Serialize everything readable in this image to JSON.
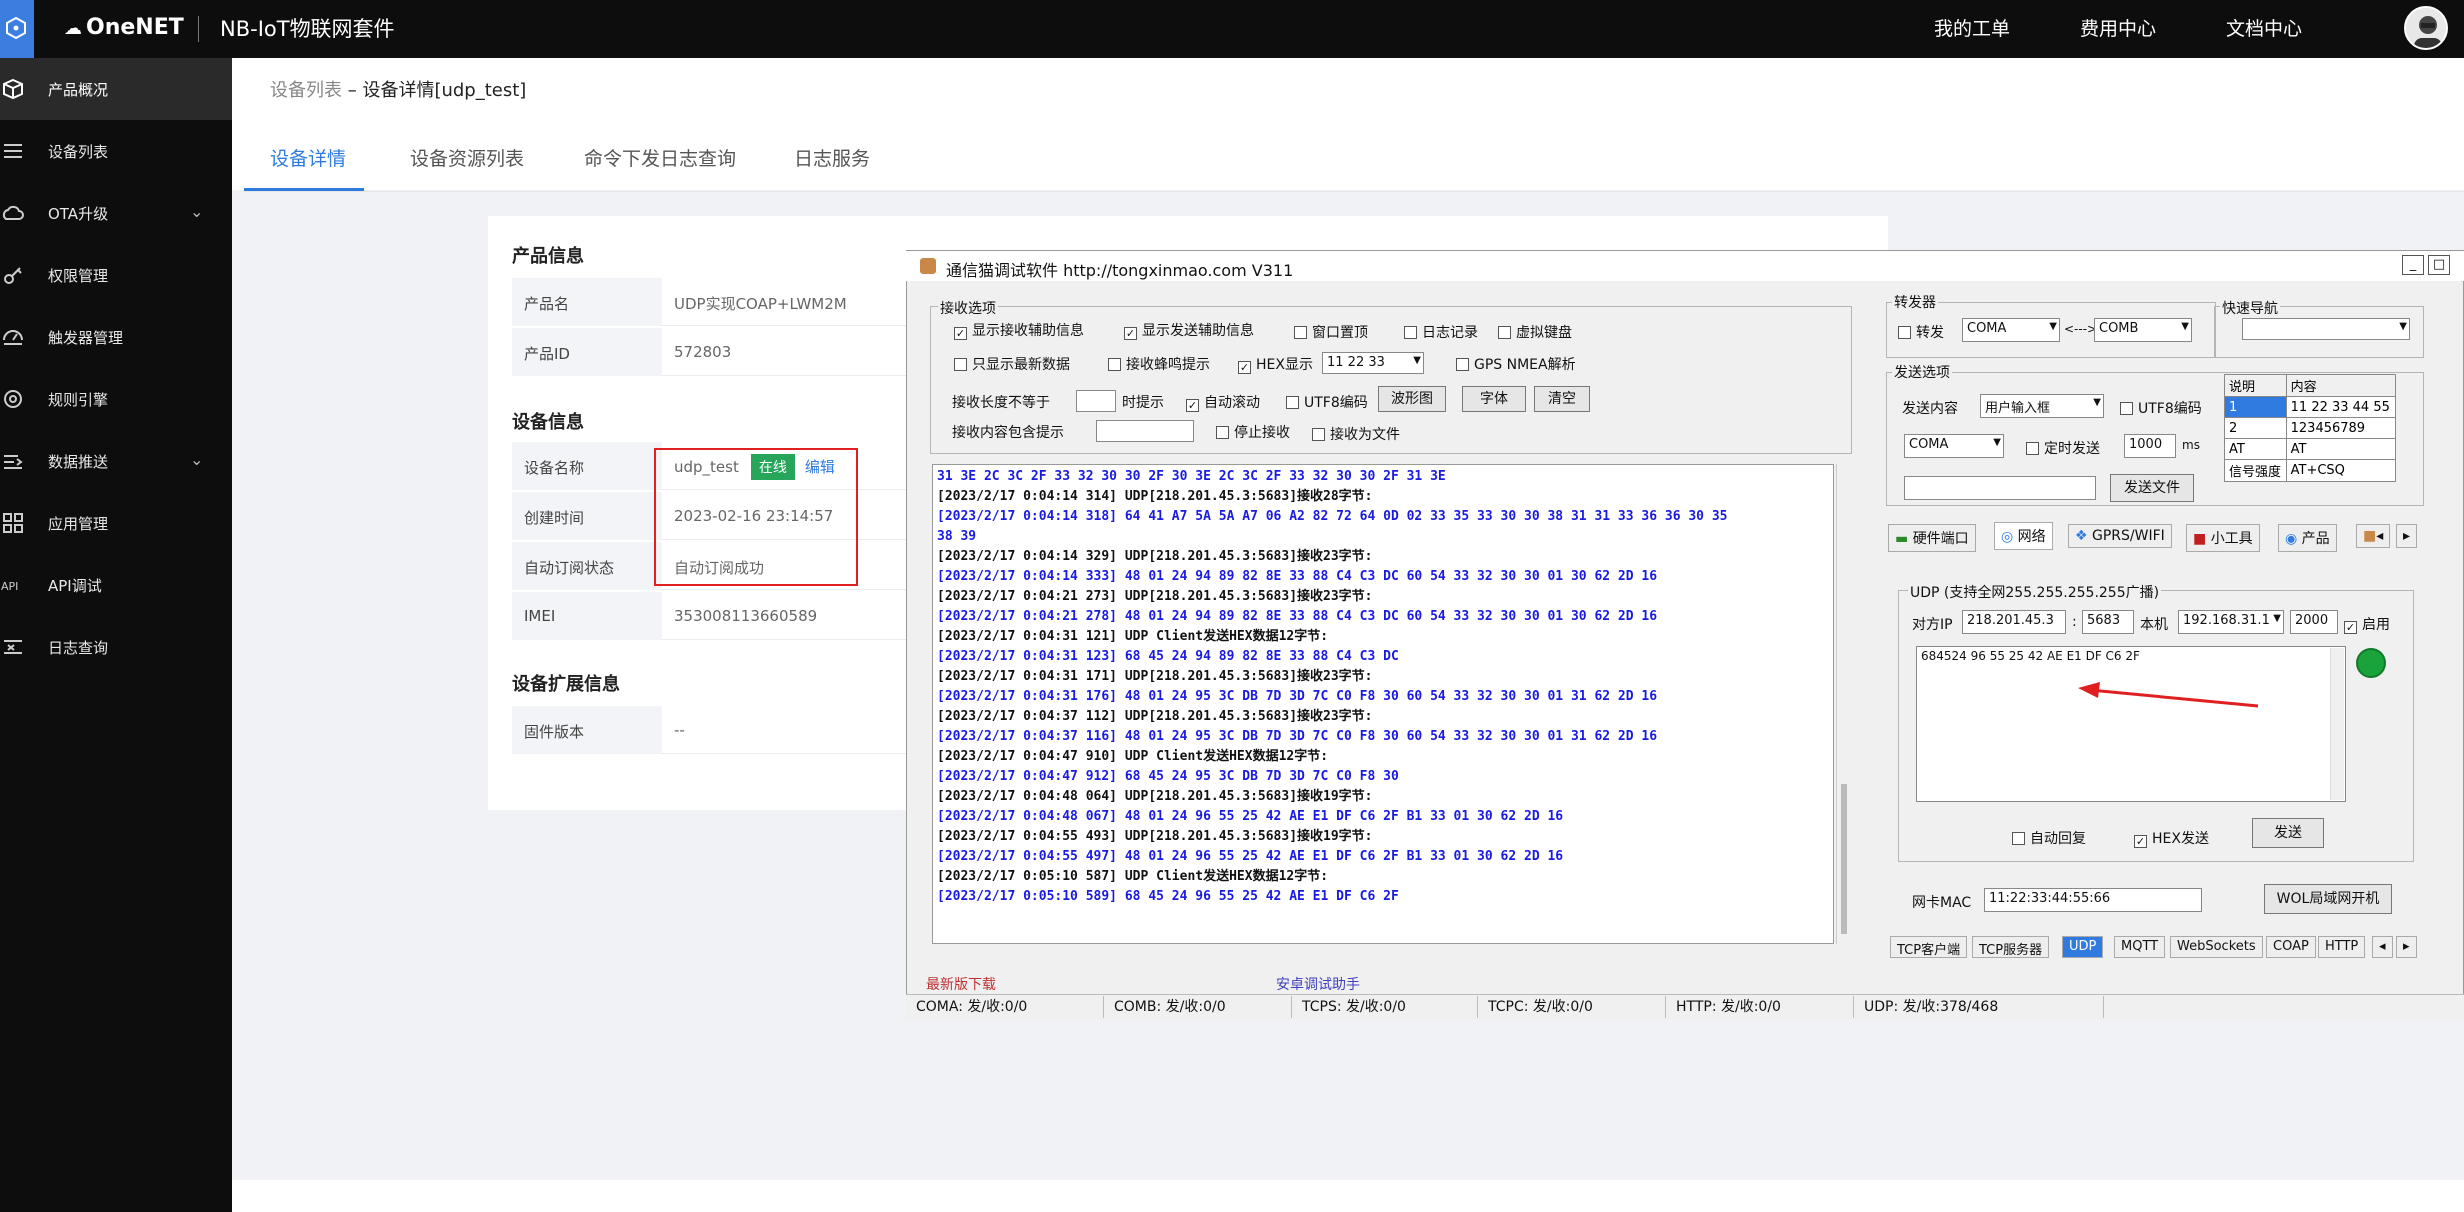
{
  "topbar": {
    "brand": "OneNET",
    "suite": "NB-IoT物联网套件",
    "nav": [
      "我的工单",
      "费用中心",
      "文档中心"
    ]
  },
  "sidebar": {
    "items": [
      {
        "label": "产品概况",
        "icon": "cube-icon",
        "active": true
      },
      {
        "label": "设备列表",
        "icon": "list-icon"
      },
      {
        "label": "OTA升级",
        "icon": "cloud-upload-icon",
        "expand": true
      },
      {
        "label": "权限管理",
        "icon": "key-icon"
      },
      {
        "label": "触发器管理",
        "icon": "trigger-icon"
      },
      {
        "label": "规则引擎",
        "icon": "rule-icon"
      },
      {
        "label": "数据推送",
        "icon": "push-icon",
        "expand": true
      },
      {
        "label": "应用管理",
        "icon": "grid-icon"
      },
      {
        "label": "API调试",
        "icon": "api-icon"
      },
      {
        "label": "日志查询",
        "icon": "log-icon"
      }
    ],
    "chevron": "⌄"
  },
  "breadcrumb": {
    "parent": "设备列表",
    "sep": " – ",
    "current": "设备详情[udp_test]"
  },
  "tabs": [
    "设备详情",
    "设备资源列表",
    "命令下发日志查询",
    "日志服务"
  ],
  "product": {
    "title": "产品信息",
    "rows": [
      {
        "key": "产品名",
        "value": "UDP实现COAP+LWM2M"
      },
      {
        "key": "产品ID",
        "value": "572803"
      }
    ]
  },
  "device": {
    "title": "设备信息",
    "name_key": "设备名称",
    "name_value": "udp_test",
    "status": "在线",
    "edit": "编辑",
    "rows": [
      {
        "key": "创建时间",
        "value": "2023-02-16 23:14:57"
      },
      {
        "key": "自动订阅状态",
        "value": "自动订阅成功"
      },
      {
        "key": "IMEI",
        "value": "353008113660589"
      }
    ]
  },
  "extension": {
    "title": "设备扩展信息",
    "rows": [
      {
        "key": "固件版本",
        "value": "--"
      }
    ]
  },
  "tool": {
    "title": "通信猫调试软件   http://tongxinmao.com   V311",
    "win_buttons": [
      "_",
      "□"
    ],
    "recv_group": "接收选项",
    "recv_opts": [
      {
        "label": "显示接收辅助信息",
        "checked": true
      },
      {
        "label": "显示发送辅助信息",
        "checked": true
      },
      {
        "label": "窗口置顶",
        "checked": false
      },
      {
        "label": "日志记录",
        "checked": false
      },
      {
        "label": "虚拟键盘",
        "checked": false
      },
      {
        "label": "只显示最新数据",
        "checked": false
      },
      {
        "label": "接收蜂鸣提示",
        "checked": false
      },
      {
        "label": "HEX显示",
        "checked": true
      },
      {
        "label": "GPS NMEA解析",
        "checked": false
      },
      {
        "label": "自动滚动",
        "checked": true
      },
      {
        "label": "UTF8编码",
        "checked": false
      },
      {
        "label": "停止接收",
        "checked": false
      },
      {
        "label": "接收为文件",
        "checked": false
      }
    ],
    "hex_sample": "11 22 33",
    "len_label": "接收长度不等于",
    "len_hint": "时提示",
    "contain_label": "接收内容包含提示",
    "btn_wave": "波形图",
    "btn_font": "字体",
    "btn_clear": "清空",
    "forward": {
      "group": "转发器",
      "cb": "转发",
      "from": "COMA",
      "arrow": "<--->",
      "to": "COMB"
    },
    "quick": {
      "group": "快速导航",
      "value": ""
    },
    "send": {
      "group": "发送选项",
      "content_label": "发送内容",
      "content_value": "用户输入框",
      "utf8": "UTF8编码",
      "port": "COMA",
      "timer": "定时发送",
      "interval": "1000",
      "unit": "ms",
      "file_btn": "发送文件"
    },
    "quick_table": {
      "headers": [
        "说明",
        "内容"
      ],
      "rows": [
        [
          "1",
          "11 22 33 44 55"
        ],
        [
          "2",
          "123456789"
        ],
        [
          "AT",
          "AT"
        ],
        [
          "信号强度",
          "AT+CSQ"
        ]
      ]
    },
    "mid_tabs": [
      "硬件端口",
      "网络",
      "GPRS/WIFI",
      "小工具",
      "产品",
      "◂",
      "▸"
    ],
    "udp": {
      "group": "UDP (支持全网255.255.255.255广播)",
      "peer_label": "对方IP",
      "peer_ip": "218.201.45.3",
      "peer_port": "5683",
      "local_label": "本机",
      "local_ip": "192.168.31.1",
      "local_port": "2000",
      "enable": "启用",
      "send_text": "684524 96 55 25 42 AE E1 DF C6 2F",
      "auto_reply": "自动回复",
      "hex_send": "HEX发送",
      "send_btn": "发送"
    },
    "mac_label": "网卡MAC",
    "mac": "11:22:33:44:55:66",
    "wol_btn": "WOL局域网开机",
    "bottom_tabs": [
      "TCP客户端",
      "TCP服务器",
      "UDP",
      "MQTT",
      "WebSockets",
      "COAP",
      "HTTP",
      "◂",
      "▸"
    ],
    "links": [
      "最新版下载",
      "安卓调试助手"
    ],
    "status": [
      "COMA: 发/收:0/0",
      "COMB: 发/收:0/0",
      "TCPS: 发/收:0/0",
      "TCPC: 发/收:0/0",
      "HTTP: 发/收:0/0",
      "UDP: 发/收:378/468"
    ],
    "log": [
      {
        "t": "31 3E 2C 3C 2F 33 32 30 30 2F 30 3E 2C 3C 2F 33 32 30 30 2F 31 3E",
        "c": "blue"
      },
      {
        "t": "[2023/2/17 0:04:14 314]  UDP[218.201.45.3:5683]接收28字节:",
        "c": "blk"
      },
      {
        "t": "[2023/2/17 0:04:14 318]  64 41 A7 5A 5A A7 06 A2 82 72 64 0D 02 33 35 33 30 30 38 31 31 33 36 36 30 35",
        "c": "blue"
      },
      {
        "t": "38 39",
        "c": "blue"
      },
      {
        "t": "[2023/2/17 0:04:14 329]  UDP[218.201.45.3:5683]接收23字节:",
        "c": "blk"
      },
      {
        "t": "[2023/2/17 0:04:14 333]  48 01 24 94 89 82 8E 33 88 C4 C3 DC 60 54 33 32 30 30 01 30 62 2D 16",
        "c": "blue"
      },
      {
        "t": "[2023/2/17 0:04:21 273]  UDP[218.201.45.3:5683]接收23字节:",
        "c": "blk"
      },
      {
        "t": "[2023/2/17 0:04:21 278]  48 01 24 94 89 82 8E 33 88 C4 C3 DC 60 54 33 32 30 30 01 30 62 2D 16",
        "c": "blue"
      },
      {
        "t": "[2023/2/17 0:04:31 121]  UDP Client发送HEX数据12字节:",
        "c": "blk"
      },
      {
        "t": "[2023/2/17 0:04:31 123]  68 45 24 94 89 82 8E 33 88 C4 C3 DC",
        "c": "blue"
      },
      {
        "t": "[2023/2/17 0:04:31 171]  UDP[218.201.45.3:5683]接收23字节:",
        "c": "blk"
      },
      {
        "t": "[2023/2/17 0:04:31 176]  48 01 24 95 3C DB 7D 3D 7C C0 F8 30 60 54 33 32 30 30 01 31 62 2D 16",
        "c": "blue"
      },
      {
        "t": "[2023/2/17 0:04:37 112]  UDP[218.201.45.3:5683]接收23字节:",
        "c": "blk"
      },
      {
        "t": "[2023/2/17 0:04:37 116]  48 01 24 95 3C DB 7D 3D 7C C0 F8 30 60 54 33 32 30 30 01 31 62 2D 16",
        "c": "blue"
      },
      {
        "t": "[2023/2/17 0:04:47 910]  UDP Client发送HEX数据12字节:",
        "c": "blk"
      },
      {
        "t": "[2023/2/17 0:04:47 912]  68 45 24 95 3C DB 7D 3D 7C C0 F8 30",
        "c": "blue"
      },
      {
        "t": "[2023/2/17 0:04:48 064]  UDP[218.201.45.3:5683]接收19字节:",
        "c": "blk"
      },
      {
        "t": "[2023/2/17 0:04:48 067]  48 01 24 96 55 25 42 AE E1 DF C6 2F B1 33 01 30 62 2D 16",
        "c": "blue"
      },
      {
        "t": "[2023/2/17 0:04:55 493]  UDP[218.201.45.3:5683]接收19字节:",
        "c": "blk"
      },
      {
        "t": "[2023/2/17 0:04:55 497]  48 01 24 96 55 25 42 AE E1 DF C6 2F B1 33 01 30 62 2D 16",
        "c": "blue"
      },
      {
        "t": "[2023/2/17 0:05:10 587]  UDP Client发送HEX数据12字节:",
        "c": "blk"
      },
      {
        "t": "[2023/2/17 0:05:10 589]  68 45 24 96 55 25 42 AE E1 DF C6 2F",
        "c": "blue"
      }
    ]
  },
  "colors": {
    "accent": "#2f7bdf",
    "online": "#27a55b",
    "highlight": "#e02020",
    "log_blue": "#1a1ae0"
  }
}
